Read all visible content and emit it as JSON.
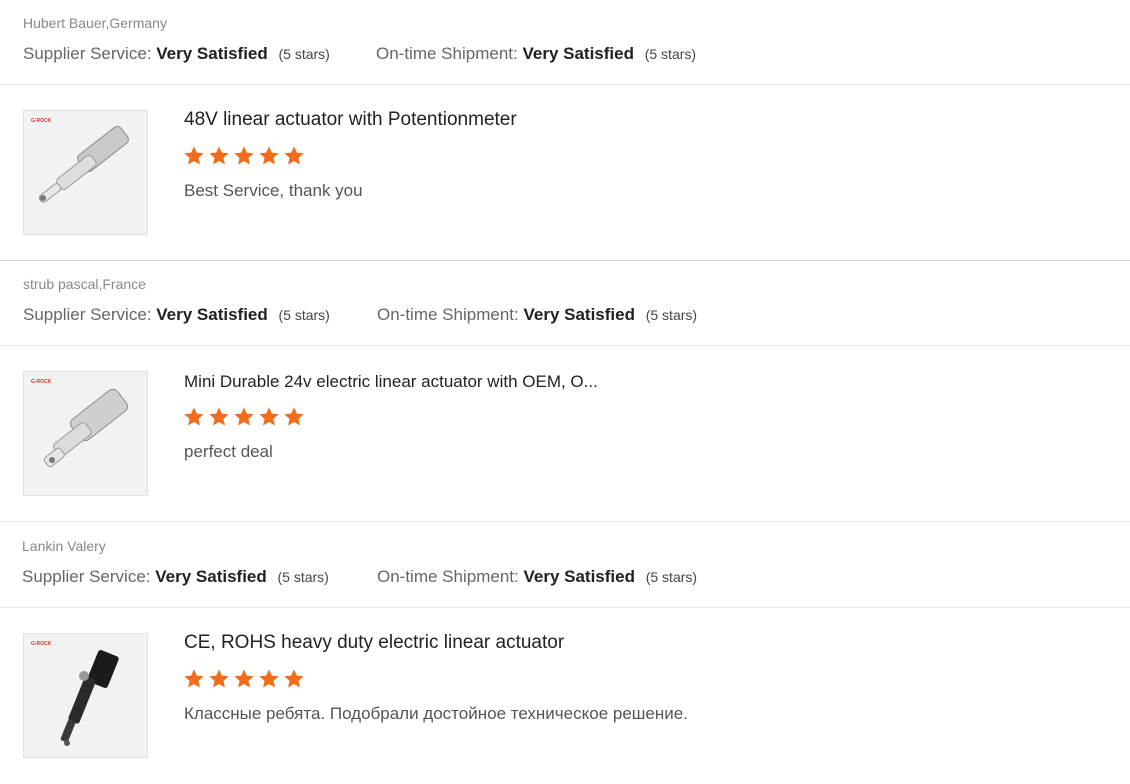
{
  "reviews": [
    {
      "reviewer": "Hubert Bauer,Germany",
      "supplier_label": "Supplier Service:",
      "supplier_value": "Very Satisfied",
      "supplier_count": "(5 stars)",
      "shipment_label": "On-time Shipment:",
      "shipment_value": "Very Satisfied",
      "shipment_count": "(5 stars)",
      "product_title": "48V linear actuator with Potentionmeter",
      "rating": 5,
      "comment": "Best Service, thank you",
      "thumb_logo": "G-ROCK",
      "thumb_icon": "silver-actuator-icon"
    },
    {
      "reviewer": "strub pascal,France",
      "supplier_label": "Supplier Service:",
      "supplier_value": "Very Satisfied",
      "supplier_count": "(5 stars)",
      "shipment_label": "On-time Shipment:",
      "shipment_value": "Very Satisfied",
      "shipment_count": "(5 stars)",
      "product_title": "Mini Durable 24v electric linear actuator with OEM, O...",
      "rating": 5,
      "comment": "perfect deal",
      "thumb_logo": "G-ROCK",
      "thumb_icon": "mini-actuator-icon"
    },
    {
      "reviewer": "Lankin Valery",
      "supplier_label": "Supplier Service:",
      "supplier_value": "Very Satisfied",
      "supplier_count": "(5 stars)",
      "shipment_label": "On-time Shipment:",
      "shipment_value": "Very Satisfied",
      "shipment_count": "(5 stars)",
      "product_title": "CE, ROHS heavy duty electric linear actuator",
      "rating": 5,
      "comment": "Классные ребята. Подобрали достойное техническое решение.",
      "thumb_logo": "G-ROCK",
      "thumb_icon": "black-actuator-icon"
    }
  ],
  "colors": {
    "star": "#f26c1c",
    "logo_green": "#3a9a3a",
    "logo_red": "#d9342b"
  }
}
